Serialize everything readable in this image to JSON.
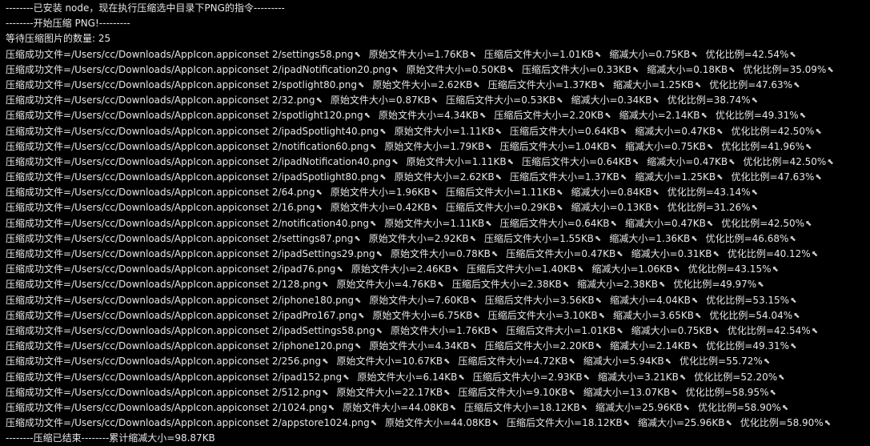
{
  "terminal": {
    "header_lines": [
      "--------已安装 node，现在执行压缩选中目录下PNG的指令---------",
      "--------开始压缩 PNG!---------",
      "等待压缩图片的数量: 25"
    ],
    "newline_glyph": "⬉",
    "labels": {
      "prefix": "压缩成功文件=",
      "original": "原始文件大小=",
      "compressed": "压缩后文件大小=",
      "reduced": "缩减大小=",
      "ratio": "优化比例="
    },
    "results": [
      {
        "path": "/Users/cc/Downloads/AppIcon.appiconset 2/settings58.png",
        "original": "1.76KB",
        "compressed": "1.01KB",
        "reduced": "0.75KB",
        "ratio": "42.54%"
      },
      {
        "path": "/Users/cc/Downloads/AppIcon.appiconset 2/ipadNotification20.png",
        "original": "0.50KB",
        "compressed": "0.33KB",
        "reduced": "0.18KB",
        "ratio": "35.09%"
      },
      {
        "path": "/Users/cc/Downloads/AppIcon.appiconset 2/spotlight80.png",
        "original": "2.62KB",
        "compressed": "1.37KB",
        "reduced": "1.25KB",
        "ratio": "47.63%"
      },
      {
        "path": "/Users/cc/Downloads/AppIcon.appiconset 2/32.png",
        "original": "0.87KB",
        "compressed": "0.53KB",
        "reduced": "0.34KB",
        "ratio": "38.74%"
      },
      {
        "path": "/Users/cc/Downloads/AppIcon.appiconset 2/spotlight120.png",
        "original": "4.34KB",
        "compressed": "2.20KB",
        "reduced": "2.14KB",
        "ratio": "49.31%"
      },
      {
        "path": "/Users/cc/Downloads/AppIcon.appiconset 2/ipadSpotlight40.png",
        "original": "1.11KB",
        "compressed": "0.64KB",
        "reduced": "0.47KB",
        "ratio": "42.50%"
      },
      {
        "path": "/Users/cc/Downloads/AppIcon.appiconset 2/notification60.png",
        "original": "1.79KB",
        "compressed": "1.04KB",
        "reduced": "0.75KB",
        "ratio": "41.96%"
      },
      {
        "path": "/Users/cc/Downloads/AppIcon.appiconset 2/ipadNotification40.png",
        "original": "1.11KB",
        "compressed": "0.64KB",
        "reduced": "0.47KB",
        "ratio": "42.50%"
      },
      {
        "path": "/Users/cc/Downloads/AppIcon.appiconset 2/ipadSpotlight80.png",
        "original": "2.62KB",
        "compressed": "1.37KB",
        "reduced": "1.25KB",
        "ratio": "47.63%"
      },
      {
        "path": "/Users/cc/Downloads/AppIcon.appiconset 2/64.png",
        "original": "1.96KB",
        "compressed": "1.11KB",
        "reduced": "0.84KB",
        "ratio": "43.14%"
      },
      {
        "path": "/Users/cc/Downloads/AppIcon.appiconset 2/16.png",
        "original": "0.42KB",
        "compressed": "0.29KB",
        "reduced": "0.13KB",
        "ratio": "31.26%"
      },
      {
        "path": "/Users/cc/Downloads/AppIcon.appiconset 2/notification40.png",
        "original": "1.11KB",
        "compressed": "0.64KB",
        "reduced": "0.47KB",
        "ratio": "42.50%"
      },
      {
        "path": "/Users/cc/Downloads/AppIcon.appiconset 2/settings87.png",
        "original": "2.92KB",
        "compressed": "1.55KB",
        "reduced": "1.36KB",
        "ratio": "46.68%"
      },
      {
        "path": "/Users/cc/Downloads/AppIcon.appiconset 2/ipadSettings29.png",
        "original": "0.78KB",
        "compressed": "0.47KB",
        "reduced": "0.31KB",
        "ratio": "40.12%"
      },
      {
        "path": "/Users/cc/Downloads/AppIcon.appiconset 2/ipad76.png",
        "original": "2.46KB",
        "compressed": "1.40KB",
        "reduced": "1.06KB",
        "ratio": "43.15%"
      },
      {
        "path": "/Users/cc/Downloads/AppIcon.appiconset 2/128.png",
        "original": "4.76KB",
        "compressed": "2.38KB",
        "reduced": "2.38KB",
        "ratio": "49.97%"
      },
      {
        "path": "/Users/cc/Downloads/AppIcon.appiconset 2/iphone180.png",
        "original": "7.60KB",
        "compressed": "3.56KB",
        "reduced": "4.04KB",
        "ratio": "53.15%"
      },
      {
        "path": "/Users/cc/Downloads/AppIcon.appiconset 2/ipadPro167.png",
        "original": "6.75KB",
        "compressed": "3.10KB",
        "reduced": "3.65KB",
        "ratio": "54.04%"
      },
      {
        "path": "/Users/cc/Downloads/AppIcon.appiconset 2/ipadSettings58.png",
        "original": "1.76KB",
        "compressed": "1.01KB",
        "reduced": "0.75KB",
        "ratio": "42.54%"
      },
      {
        "path": "/Users/cc/Downloads/AppIcon.appiconset 2/iphone120.png",
        "original": "4.34KB",
        "compressed": "2.20KB",
        "reduced": "2.14KB",
        "ratio": "49.31%"
      },
      {
        "path": "/Users/cc/Downloads/AppIcon.appiconset 2/256.png",
        "original": "10.67KB",
        "compressed": "4.72KB",
        "reduced": "5.94KB",
        "ratio": "55.72%"
      },
      {
        "path": "/Users/cc/Downloads/AppIcon.appiconset 2/ipad152.png",
        "original": "6.14KB",
        "compressed": "2.93KB",
        "reduced": "3.21KB",
        "ratio": "52.20%"
      },
      {
        "path": "/Users/cc/Downloads/AppIcon.appiconset 2/512.png",
        "original": "22.17KB",
        "compressed": "9.10KB",
        "reduced": "13.07KB",
        "ratio": "58.95%"
      },
      {
        "path": "/Users/cc/Downloads/AppIcon.appiconset 2/1024.png",
        "original": "44.08KB",
        "compressed": "18.12KB",
        "reduced": "25.96KB",
        "ratio": "58.90%"
      },
      {
        "path": "/Users/cc/Downloads/AppIcon.appiconset 2/appstore1024.png",
        "original": "44.08KB",
        "compressed": "18.12KB",
        "reduced": "25.96KB",
        "ratio": "58.90%"
      }
    ],
    "footer_line": "--------压缩已结束--------累计缩减大小=98.87KB"
  }
}
